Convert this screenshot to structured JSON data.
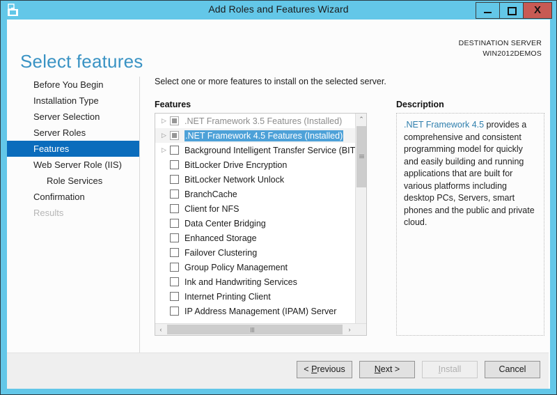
{
  "window": {
    "title": "Add Roles and Features Wizard",
    "icon": "wizard-toolbox-icon",
    "controls": {
      "minimize": "–",
      "maximize": "❐",
      "close": "X"
    },
    "accent_color": "#63c7e8"
  },
  "header": {
    "page_title": "Select features",
    "destination_label": "DESTINATION SERVER",
    "destination_server": "WIN2012DEMOS"
  },
  "sidebar": {
    "items": [
      {
        "label": "Before You Begin",
        "state": "normal"
      },
      {
        "label": "Installation Type",
        "state": "normal"
      },
      {
        "label": "Server Selection",
        "state": "normal"
      },
      {
        "label": "Server Roles",
        "state": "normal"
      },
      {
        "label": "Features",
        "state": "active"
      },
      {
        "label": "Web Server Role (IIS)",
        "state": "normal"
      },
      {
        "label": "Role Services",
        "state": "sub"
      },
      {
        "label": "Confirmation",
        "state": "normal"
      },
      {
        "label": "Results",
        "state": "disabled"
      }
    ],
    "active_color": "#0a6cbc"
  },
  "main": {
    "instruction": "Select one or more features to install on the selected server.",
    "features_label": "Features",
    "description_label": "Description",
    "features": [
      {
        "label": ".NET Framework 3.5 Features (Installed)",
        "checkbox": "installed",
        "expander": true,
        "dim": true,
        "selected": false
      },
      {
        "label": ".NET Framework 4.5 Features (Installed)",
        "checkbox": "installed",
        "expander": true,
        "dim": false,
        "selected": true
      },
      {
        "label": "Background Intelligent Transfer Service (BITS)",
        "checkbox": "unchecked",
        "expander": true,
        "dim": false,
        "selected": false
      },
      {
        "label": "BitLocker Drive Encryption",
        "checkbox": "unchecked",
        "expander": false,
        "dim": false,
        "selected": false
      },
      {
        "label": "BitLocker Network Unlock",
        "checkbox": "unchecked",
        "expander": false,
        "dim": false,
        "selected": false
      },
      {
        "label": "BranchCache",
        "checkbox": "unchecked",
        "expander": false,
        "dim": false,
        "selected": false
      },
      {
        "label": "Client for NFS",
        "checkbox": "unchecked",
        "expander": false,
        "dim": false,
        "selected": false
      },
      {
        "label": "Data Center Bridging",
        "checkbox": "unchecked",
        "expander": false,
        "dim": false,
        "selected": false
      },
      {
        "label": "Enhanced Storage",
        "checkbox": "unchecked",
        "expander": false,
        "dim": false,
        "selected": false
      },
      {
        "label": "Failover Clustering",
        "checkbox": "unchecked",
        "expander": false,
        "dim": false,
        "selected": false
      },
      {
        "label": "Group Policy Management",
        "checkbox": "unchecked",
        "expander": false,
        "dim": false,
        "selected": false
      },
      {
        "label": "Ink and Handwriting Services",
        "checkbox": "unchecked",
        "expander": false,
        "dim": false,
        "selected": false
      },
      {
        "label": "Internet Printing Client",
        "checkbox": "unchecked",
        "expander": false,
        "dim": false,
        "selected": false
      },
      {
        "label": "IP Address Management (IPAM) Server",
        "checkbox": "unchecked",
        "expander": false,
        "dim": false,
        "selected": false
      }
    ],
    "description": {
      "link_text": ".NET Framework 4.5",
      "body_text": " provides a comprehensive and consistent programming model for quickly and easily building and running applications that are built for various platforms including desktop PCs, Servers, smart phones and the public and private cloud.",
      "link_color": "#2f7fad"
    },
    "scrollbars": {
      "vertical_up": "⌃",
      "vertical_down": "⌄",
      "horizontal_left": "‹",
      "horizontal_right": "›"
    },
    "expander_glyph": "▷"
  },
  "footer": {
    "buttons": [
      {
        "prefix": "< ",
        "accel": "P",
        "suffix": "revious",
        "disabled": false,
        "name": "previous"
      },
      {
        "prefix": "",
        "accel": "N",
        "suffix": "ext >",
        "disabled": false,
        "name": "next"
      },
      {
        "prefix": "",
        "accel": "I",
        "suffix": "nstall",
        "disabled": true,
        "name": "install"
      },
      {
        "prefix": "",
        "accel": "",
        "suffix": "Cancel",
        "disabled": false,
        "name": "cancel"
      }
    ]
  }
}
